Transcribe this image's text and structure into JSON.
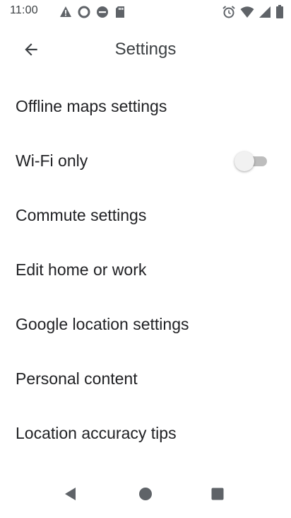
{
  "status_bar": {
    "time": "11:00",
    "left_icons": [
      "alert-icon",
      "data-saver-icon",
      "do-not-disturb-icon",
      "sd-card-icon"
    ],
    "right_icons": [
      "alarm-icon",
      "wifi-icon",
      "signal-icon",
      "battery-icon"
    ]
  },
  "app_bar": {
    "title": "Settings",
    "back_icon": "arrow-back-icon"
  },
  "settings": {
    "items": [
      {
        "label": "Offline maps settings"
      },
      {
        "label": "Wi-Fi only",
        "toggle": false
      },
      {
        "label": "Commute settings"
      },
      {
        "label": "Edit home or work"
      },
      {
        "label": "Google location settings"
      },
      {
        "label": "Personal content"
      },
      {
        "label": "Location accuracy tips"
      }
    ]
  },
  "nav_bar": {
    "icons": [
      "back-triangle-icon",
      "home-circle-icon",
      "recents-square-icon"
    ]
  },
  "colors": {
    "text": "#202124",
    "icon": "#5f6368",
    "toggle_track_off": "#bdbdbd",
    "toggle_thumb_off": "#f1f1f1"
  }
}
